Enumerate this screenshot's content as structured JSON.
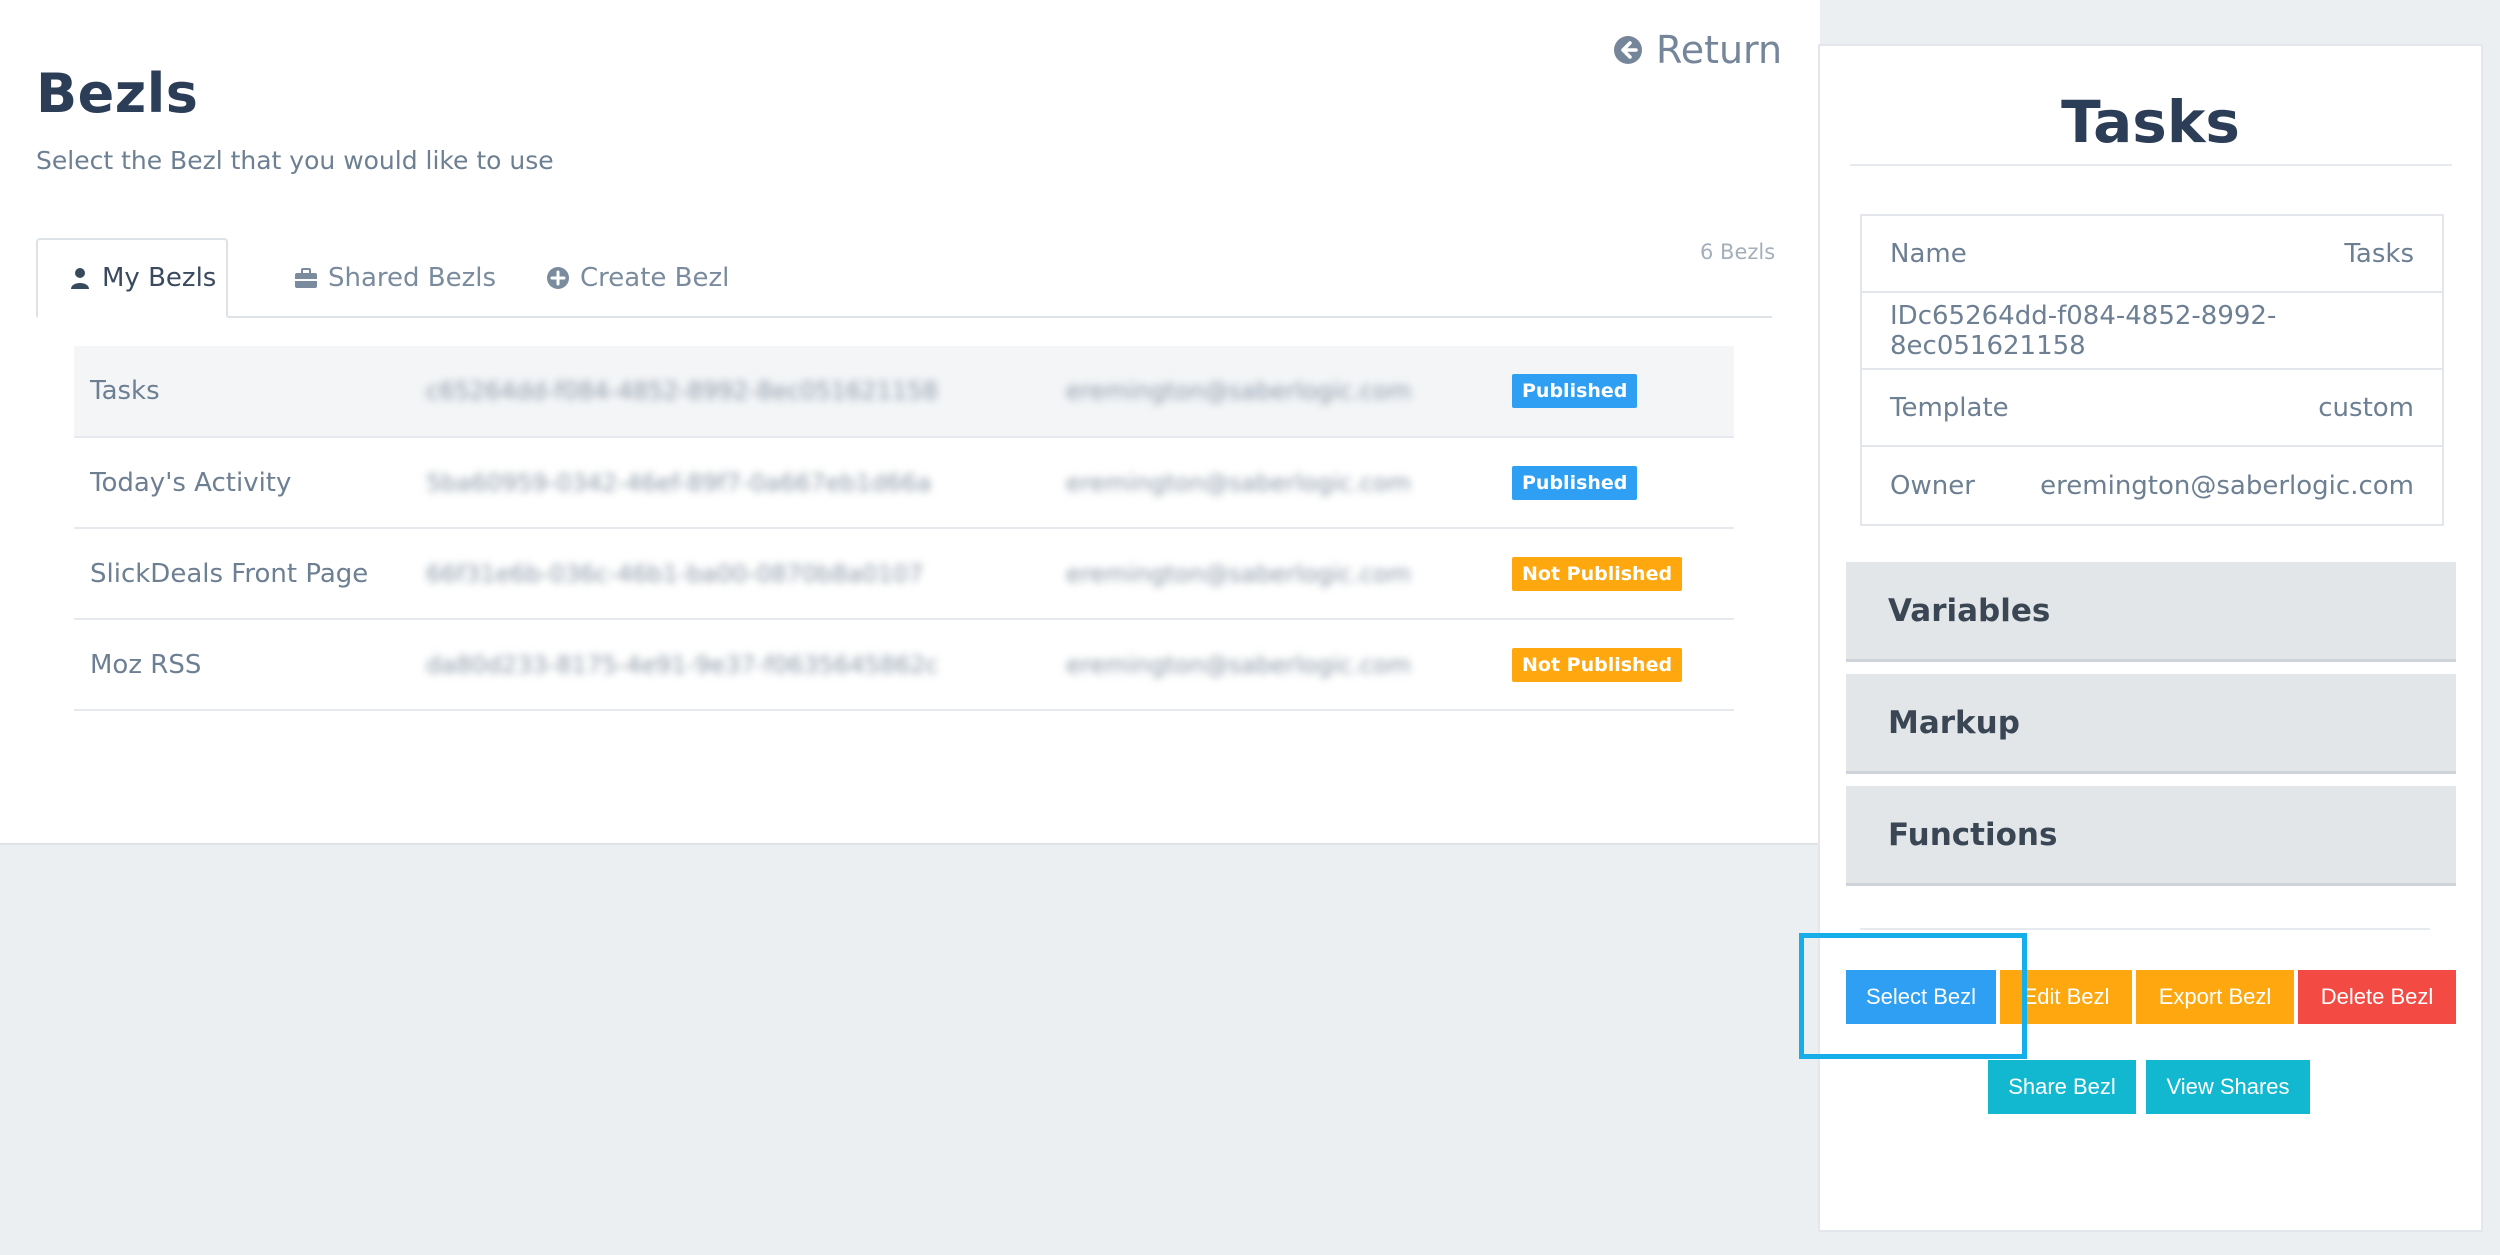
{
  "header": {
    "title": "Bezls",
    "subtitle": "Select the Bezl that you would like to use",
    "return_label": "Return",
    "bezl_count": "6 Bezls"
  },
  "tabs": [
    {
      "label": "My Bezls",
      "icon": "user-icon",
      "active": true
    },
    {
      "label": "Shared Bezls",
      "icon": "briefcase-icon",
      "active": false
    },
    {
      "label": "Create Bezl",
      "icon": "plus-circle-icon",
      "active": false
    }
  ],
  "bezls": [
    {
      "name": "Tasks",
      "id": "c65264dd-f084-4852-8992-8ec051621158",
      "owner": "eremington@saberlogic.com",
      "status": "Published"
    },
    {
      "name": "Today's Activity",
      "id": "5ba60959-0342-46ef-89f7-0a667eb1d66a",
      "owner": "eremington@saberlogic.com",
      "status": "Published"
    },
    {
      "name": "SlickDeals Front Page",
      "id": "66f31e6b-036c-46b1-ba00-0870b8a0107",
      "owner": "eremington@saberlogic.com",
      "status": "Not Published"
    },
    {
      "name": "Moz RSS",
      "id": "da80d233-8175-4e91-9e37-f0635645862c",
      "owner": "eremington@saberlogic.com",
      "status": "Not Published"
    }
  ],
  "detail": {
    "title": "Tasks",
    "name_label": "Name",
    "name_value": "Tasks",
    "id_line": "IDc65264dd-f084-4852-8992-8ec051621158",
    "template_label": "Template",
    "template_value": "custom",
    "owner_label": "Owner",
    "owner_value": "eremington@saberlogic.com",
    "sections": [
      "Variables",
      "Markup",
      "Functions"
    ]
  },
  "actions": {
    "select": "Select Bezl",
    "edit": "Edit Bezl",
    "export": "Export Bezl",
    "delete": "Delete Bezl",
    "share": "Share Bezl",
    "view_shares": "View Shares"
  },
  "colors": {
    "published": "#2e9ff3",
    "not_published": "#ffa70f",
    "delete": "#f44a44",
    "share": "#12b8cf",
    "highlight": "#16aee8"
  }
}
